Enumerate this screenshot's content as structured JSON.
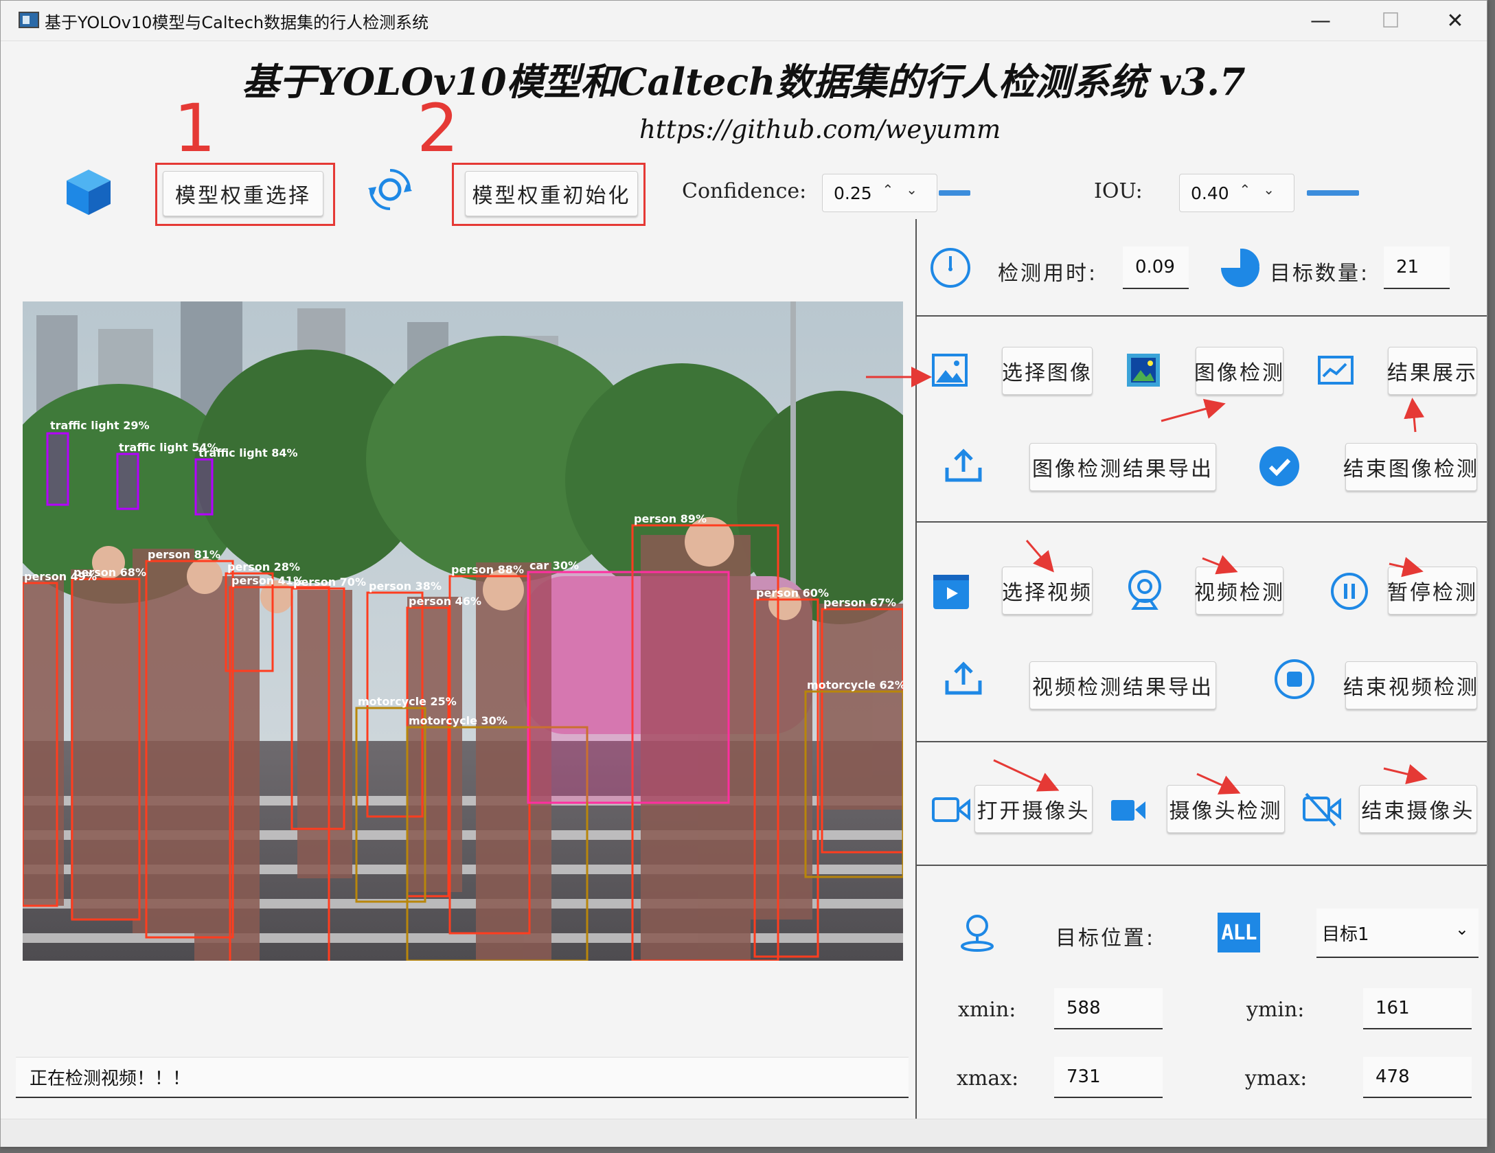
{
  "window": {
    "title": "基于YOLOv10模型与Caltech数据集的行人检测系统"
  },
  "header": {
    "title": "基于YOLOv10模型和Caltech数据集的行人检测系统 v3.7",
    "url": "https://github.com/weyumm",
    "step1": "1",
    "step2": "2"
  },
  "toolbar": {
    "weight_select_label": "模型权重选择",
    "weight_init_label": "模型权重初始化",
    "confidence_label": "Confidence:",
    "confidence_value": "0.25",
    "iou_label": "IOU:",
    "iou_value": "0.40"
  },
  "stats": {
    "time_label": "检测用时:",
    "time_value": "0.09",
    "count_label": "目标数量:",
    "count_value": "21"
  },
  "image_section": {
    "select_label": "选择图像",
    "detect_label": "图像检测",
    "show_label": "结果展示",
    "export_label": "图像检测结果导出",
    "end_label": "结束图像检测"
  },
  "video_section": {
    "select_label": "选择视频",
    "detect_label": "视频检测",
    "pause_label": "暂停检测",
    "export_label": "视频检测结果导出",
    "end_label": "结束视频检测"
  },
  "camera_section": {
    "open_label": "打开摄像头",
    "detect_label": "摄像头检测",
    "end_label": "结束摄像头"
  },
  "position": {
    "label": "目标位置:",
    "all_badge": "ALL",
    "target_selected": "目标1",
    "xmin_label": "xmin:",
    "xmin_value": "588",
    "ymin_label": "ymin:",
    "ymin_value": "161",
    "xmax_label": "xmax:",
    "xmax_value": "731",
    "ymax_label": "ymax:",
    "ymax_value": "478"
  },
  "status": {
    "message": "正在检测视频！！！"
  },
  "detections": [
    {
      "label": "traffic light 29%",
      "color": "#b400ff"
    },
    {
      "label": "traffic light 54%",
      "color": "#b400ff"
    },
    {
      "label": "traffic light 84%",
      "color": "#b400ff"
    },
    {
      "label": "person 49%",
      "color": "#ff3d1f"
    },
    {
      "label": "person 68%",
      "color": "#ff3d1f"
    },
    {
      "label": "person 81%",
      "color": "#ff3d1f"
    },
    {
      "label": "person 28%",
      "color": "#ff3d1f"
    },
    {
      "label": "person 41%",
      "color": "#ff3d1f"
    },
    {
      "label": "person 70%",
      "color": "#ff3d1f"
    },
    {
      "label": "person 38%",
      "color": "#ff3d1f"
    },
    {
      "label": "person 46%",
      "color": "#ff3d1f"
    },
    {
      "label": "person 88%",
      "color": "#ff3d1f"
    },
    {
      "label": "car 30%",
      "color": "#ff2fa0"
    },
    {
      "label": "person 89%",
      "color": "#ff3d1f"
    },
    {
      "label": "person 60%",
      "color": "#ff3d1f"
    },
    {
      "label": "person 67%",
      "color": "#ff3d1f"
    },
    {
      "label": "motorcycle 25%",
      "color": "#b8860b"
    },
    {
      "label": "motorcycle 30%",
      "color": "#b8860b"
    },
    {
      "label": "motorcycle 62%",
      "color": "#b8860b"
    }
  ],
  "colors": {
    "accent": "#1e88e5",
    "annotation_red": "#e53935"
  }
}
